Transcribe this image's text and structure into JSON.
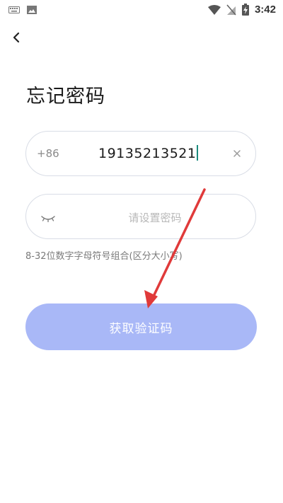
{
  "status_bar": {
    "time": "3:42",
    "icons": [
      "keyboard-icon",
      "image-icon",
      "wifi-icon",
      "no-sim-icon",
      "battery-charging-icon"
    ]
  },
  "header": {
    "back_icon": "chevron-left-icon"
  },
  "page": {
    "title": "忘记密码"
  },
  "phone_field": {
    "country_code": "+86",
    "value": "19135213521",
    "clear_icon": "close-icon"
  },
  "password_field": {
    "toggle_icon": "eye-closed-icon",
    "placeholder": "请设置密码",
    "value": ""
  },
  "hint": "8-32位数字字母符号组合(区分大小写)",
  "button": {
    "get_code_label": "获取验证码",
    "background": "#a9b8f7"
  },
  "annotation": {
    "arrow_color": "#e03a3a"
  }
}
